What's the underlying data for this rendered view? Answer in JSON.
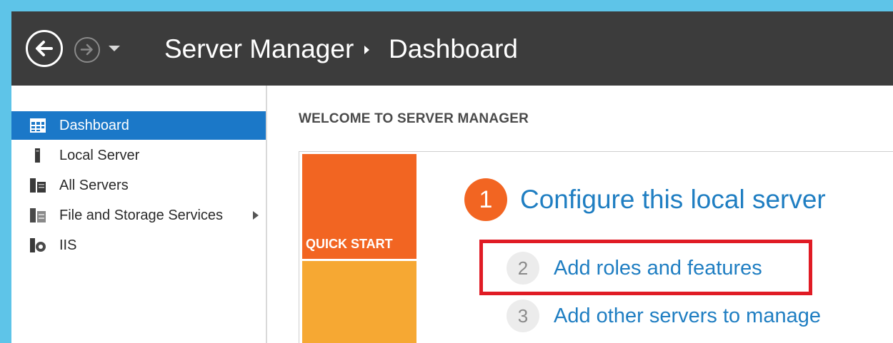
{
  "header": {
    "app_title": "Server Manager",
    "page_title": "Dashboard",
    "icons": {
      "back": "back-arrow-icon",
      "forward": "forward-arrow-icon",
      "dropdown": "chevron-down-icon",
      "breadcrumb_separator": "chevron-right-icon"
    }
  },
  "sidebar": {
    "items": [
      {
        "label": "Dashboard",
        "icon": "dashboard-grid-icon",
        "active": true
      },
      {
        "label": "Local Server",
        "icon": "server-icon"
      },
      {
        "label": "All Servers",
        "icon": "servers-icon"
      },
      {
        "label": "File and Storage Services",
        "icon": "file-storage-icon",
        "expandable": true
      },
      {
        "label": "IIS",
        "icon": "iis-icon"
      }
    ]
  },
  "main": {
    "welcome_heading": "WELCOME TO SERVER MANAGER",
    "quick_start_label": "QUICK START",
    "steps": [
      {
        "number": "1",
        "label": "Configure this local server"
      },
      {
        "number": "2",
        "label": "Add roles and features"
      },
      {
        "number": "3",
        "label": "Add other servers to manage"
      }
    ]
  },
  "colors": {
    "titlebar": "#3c3c3c",
    "accent_blue": "#1b78c8",
    "link_blue": "#1f7ec2",
    "quick_start_orange": "#f26522",
    "quick_start_light": "#f6a833",
    "highlight_red": "#e01b24",
    "window_border": "#5ec4e8"
  }
}
